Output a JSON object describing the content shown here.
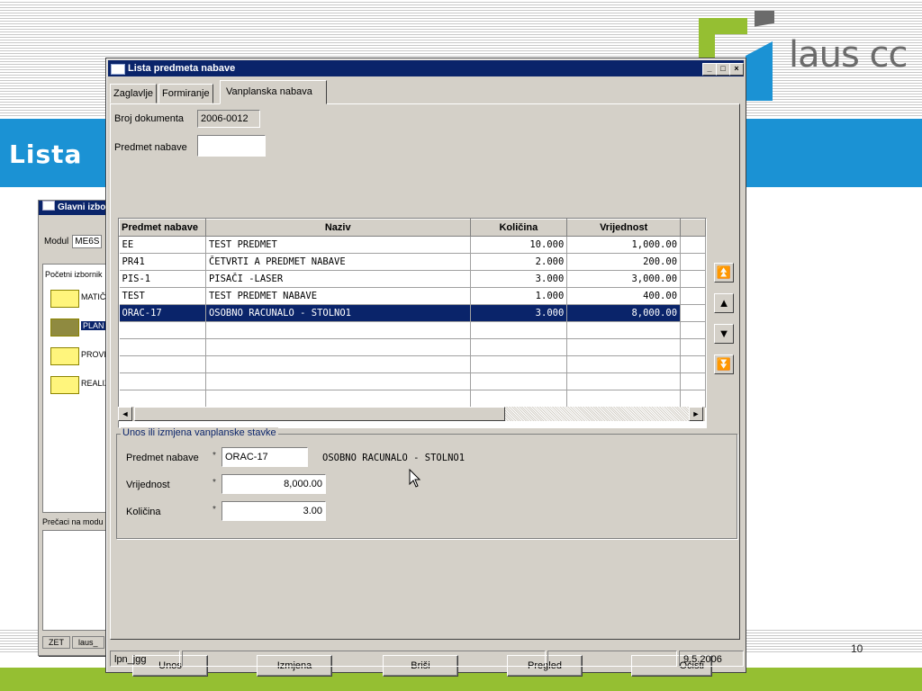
{
  "slide": {
    "title": "Lista",
    "logo_text": "laus cc",
    "page_number": "10",
    "colors": {
      "title_band": "#1b92d4",
      "footer_bar": "#95bf32",
      "logo_green": "#95bf32",
      "logo_blue": "#1b92d4",
      "logo_gray": "#6b6b6b"
    }
  },
  "background_window": {
    "title": "Glavni izbo",
    "modul_label": "Modul",
    "modul_value": "ME6S",
    "tree_header": "Početni izbornik",
    "folders": [
      {
        "label": "MATIČ",
        "selected": false
      },
      {
        "label": "PLAN N",
        "selected": true
      },
      {
        "label": "PROVE",
        "selected": false
      },
      {
        "label": "REALIZ",
        "selected": false
      }
    ],
    "shortcuts_label": "Prečaci na modu",
    "bottom_tabs": [
      "ZET",
      "laus_"
    ]
  },
  "window": {
    "title": "Lista predmeta nabave",
    "controls": {
      "minimize": "_",
      "maximize": "□",
      "close": "×"
    },
    "tabs": [
      {
        "label": "Zaglavlje",
        "active": false
      },
      {
        "label": "Formiranje",
        "active": false
      },
      {
        "label": "Vanplanska nabava",
        "active": true
      }
    ],
    "broj_dokumenta": {
      "label": "Broj dokumenta",
      "value": "2006-0012"
    },
    "predmet_nabave_filter": {
      "label": "Predmet nabave",
      "value": ""
    },
    "grid": {
      "columns": [
        "Predmet nabave",
        "Naziv",
        "Količina",
        "Vrijednost"
      ],
      "rows": [
        {
          "predmet": "EE",
          "naziv": "TEST PREDMET",
          "kolicina": "10.000",
          "vrijednost": "1,000.00",
          "selected": false
        },
        {
          "predmet": "PR41",
          "naziv": "ČETVRTI A PREDMET NABAVE",
          "kolicina": "2.000",
          "vrijednost": "200.00",
          "selected": false
        },
        {
          "predmet": "PIS-1",
          "naziv": "PISAČI -LASER",
          "kolicina": "3.000",
          "vrijednost": "3,000.00",
          "selected": false
        },
        {
          "predmet": "TEST",
          "naziv": "TEST PREDMET NABAVE",
          "kolicina": "1.000",
          "vrijednost": "400.00",
          "selected": false
        },
        {
          "predmet": "ORAC-17",
          "naziv": "OSOBNO RACUNALO - STOLNO1",
          "kolicina": "3.000",
          "vrijednost": "8,000.00",
          "selected": true
        }
      ],
      "scroll_left": "◄",
      "scroll_right": "►"
    },
    "nav_buttons": {
      "first": "⏫",
      "prev": "▲",
      "next": "▼",
      "last": "⏬"
    },
    "entry_group": {
      "title": "Unos ili izmjena vanplanske stavke",
      "required_mark": "*",
      "predmet": {
        "label": "Predmet nabave",
        "value": "ORAC-17",
        "description": "OSOBNO RACUNALO - STOLNO1"
      },
      "vrijednost": {
        "label": "Vrijednost",
        "value": "8,000.00"
      },
      "kolicina": {
        "label": "Količina",
        "value": "3.00"
      }
    },
    "buttons": {
      "unos": "Unos",
      "izmjena": "Izmjena",
      "brisi": "Briši",
      "pregled": "Pregled",
      "ocisti": "Očisti"
    },
    "status": {
      "user": "lpn_jgg",
      "middle": "",
      "extra": "",
      "date": "9.5.2006"
    }
  }
}
